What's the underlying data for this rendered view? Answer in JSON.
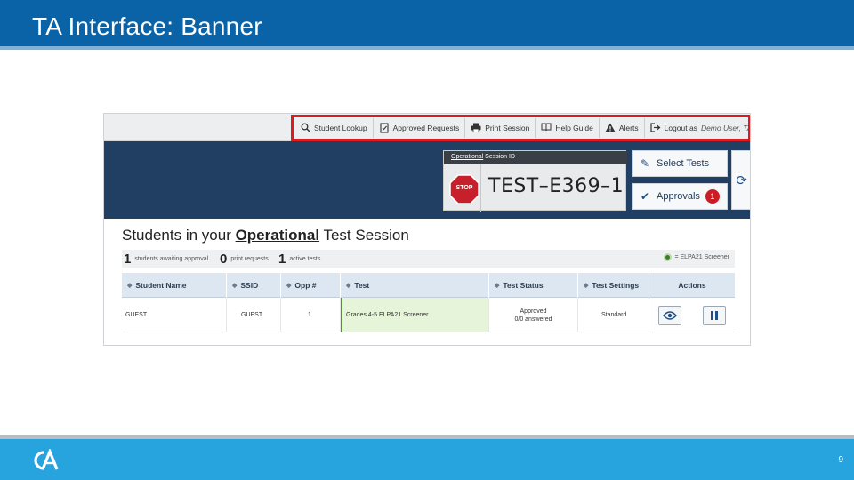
{
  "slide": {
    "title": "TA Interface: Banner",
    "page_number": "9",
    "logo_text": "CA"
  },
  "banner": {
    "items": [
      {
        "icon": "search-icon",
        "label": "Student Lookup"
      },
      {
        "icon": "document-check-icon",
        "label": "Approved Requests"
      },
      {
        "icon": "printer-icon",
        "label": "Print Session"
      },
      {
        "icon": "book-icon",
        "label": "Help Guide"
      },
      {
        "icon": "warning-icon",
        "label": "Alerts"
      },
      {
        "icon": "logout-icon",
        "label": "Logout as",
        "user": "Demo User, TA"
      }
    ],
    "highlight_color": "#e0191e"
  },
  "session": {
    "label_prefix": "Operational",
    "label_suffix": " Session ID",
    "id": "TEST–E369–1",
    "stop_label": "STOP"
  },
  "buttons": {
    "select_tests": "Select Tests",
    "approvals": "Approvals",
    "approvals_count": "1"
  },
  "heading": {
    "before": "Students in your ",
    "emphasis": "Operational",
    "after": " Test Session"
  },
  "counts": [
    {
      "value": "1",
      "label": "students awaiting approval"
    },
    {
      "value": "0",
      "label": "print requests"
    },
    {
      "value": "1",
      "label": "active tests"
    }
  ],
  "legend": {
    "label": "= ELPA21 Screener",
    "color": "#3d7d2c"
  },
  "table": {
    "columns": [
      "Student Name",
      "SSID",
      "Opp #",
      "Test",
      "Test Status",
      "Test Settings",
      "Actions"
    ],
    "rows": [
      {
        "student_name": "GUEST",
        "ssid": "GUEST",
        "opp": "1",
        "test": "Grades 4-5 ELPA21 Screener",
        "status_line1": "Approved",
        "status_line2": "0/0 answered",
        "settings": "Standard"
      }
    ]
  },
  "colors": {
    "header_blue": "#0b63a7",
    "footer_blue": "#27a4dd",
    "hero_navy": "#203f63"
  }
}
